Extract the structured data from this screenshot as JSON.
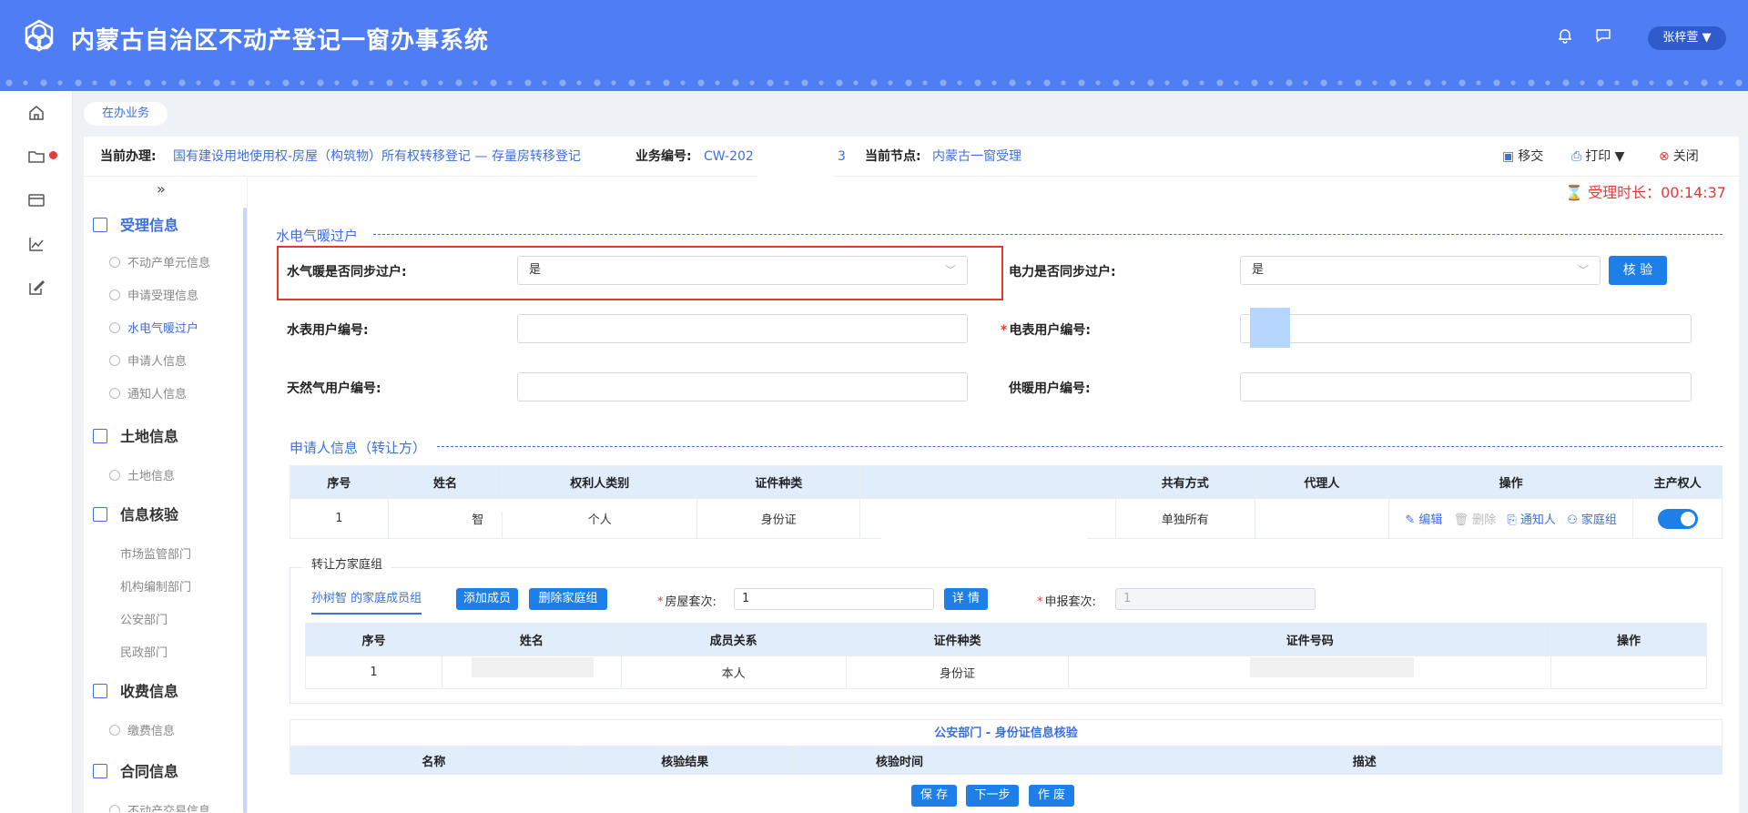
{
  "header": {
    "title": "内蒙古自治区不动产登记一窗办事系统",
    "user": "张梓萱"
  },
  "tab": {
    "label": "在办业务"
  },
  "infobar": {
    "current_label": "当前办理:",
    "current_value": "国有建设用地使用权-房屋（构筑物）所有权转移登记 — 存量房转移登记",
    "biz_label": "业务编号:",
    "biz_value": "CW-202",
    "biz_tail": "3",
    "node_label": "当前节点:",
    "node_value": "内蒙古一窗受理",
    "transfer": "移交",
    "print": "打印",
    "close": "关闭"
  },
  "timer": "受理时长：00:14:37",
  "side": {
    "collapse": "»",
    "groups": [
      {
        "label": "受理信息"
      },
      {
        "label": "土地信息"
      },
      {
        "label": "信息核验"
      },
      {
        "label": "收费信息"
      },
      {
        "label": "合同信息"
      }
    ],
    "items": {
      "unit": "不动产单元信息",
      "apply": "申请受理信息",
      "utility": "水电气暖过户",
      "applicant": "申请人信息",
      "notify": "通知人信息",
      "land": "土地信息",
      "market": "市场监管部门",
      "org": "机构编制部门",
      "police": "公安部门",
      "civil": "民政部门",
      "fee": "缴费信息",
      "contract": "不动产交易信息"
    }
  },
  "utility": {
    "section": "水电气暖过户",
    "water_sync_label": "水气暖是否同步过户:",
    "water_sync_value": "是",
    "power_sync_label": "电力是否同步过户:",
    "power_sync_value": "是",
    "verify": "核 验",
    "water_no_label": "水表用户编号:",
    "power_no_label": "电表用户编号:",
    "gas_no_label": "天然气用户编号:",
    "heat_no_label": "供暖用户编号:"
  },
  "applicant": {
    "section": "申请人信息（转让方）",
    "headers": [
      "序号",
      "姓名",
      "权利人类别",
      "证件种类",
      "",
      "共有方式",
      "代理人",
      "操作",
      "主产权人"
    ],
    "row": {
      "index": "1",
      "name": "智",
      "category": "个人",
      "idtype": "身份证",
      "share": "单独所有"
    },
    "ops": {
      "edit": "编辑",
      "delete": "删除",
      "notify": "通知人",
      "family": "家庭组"
    }
  },
  "family": {
    "title": "转让方家庭组",
    "tab": "孙树智 的家庭成员组",
    "add": "添加成员",
    "remove": "删除家庭组",
    "house_label": "房屋套次:",
    "house_value": "1",
    "detail": "详 情",
    "declare_label": "申报套次:",
    "declare_value": "1",
    "headers": [
      "序号",
      "姓名",
      "成员关系",
      "证件种类",
      "证件号码",
      "操作"
    ],
    "row": {
      "index": "1",
      "relation": "本人",
      "idtype": "身份证"
    }
  },
  "verify": {
    "title": "公安部门 - 身份证信息核验",
    "headers": [
      "名称",
      "核验结果",
      "核验时间",
      "描述"
    ]
  },
  "actions": {
    "save": "保 存",
    "next": "下一步",
    "void": "作 废"
  }
}
